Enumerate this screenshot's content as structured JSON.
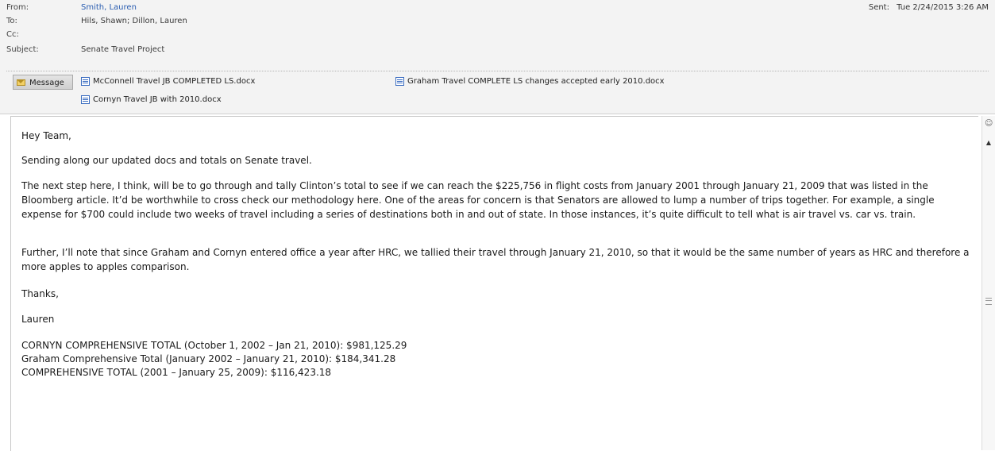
{
  "header": {
    "from_label": "From:",
    "from_value": "Smith, Lauren",
    "to_label": "To:",
    "to_value": "Hils, Shawn; Dillon, Lauren",
    "cc_label": "Cc:",
    "cc_value": "",
    "subject_label": "Subject:",
    "subject_value": "Senate Travel Project",
    "sent_label": "Sent:",
    "sent_value": "Tue 2/24/2015 3:26 AM"
  },
  "attachments": {
    "message_tab": "Message",
    "items": [
      "McConnell Travel JB COMPLETED LS.docx",
      "Graham Travel COMPLETE LS changes accepted early 2010.docx",
      "Cornyn Travel JB with 2010.docx"
    ]
  },
  "body": {
    "greeting": "Hey Team,",
    "p1": "Sending along our updated docs and totals on Senate travel.",
    "p2": "The next step here, I think, will be to go through and tally Clinton’s total to see if we can reach the $225,756 in flight costs from January 2001 through January 21, 2009 that was listed in the Bloomberg article. It’d be worthwhile to cross check our methodology here. One of the areas for concern is that Senators are allowed to lump a number of trips together. For example, a single expense for $700 could include two weeks of travel including a series of destinations both in and out of state. In those instances, it’s quite difficult to tell what is air travel vs. car vs. train.",
    "p3": "Further, I’ll note that since Graham and Cornyn entered office a year after HRC, we tallied their travel through January 21, 2010, so that it would be the same number of years as HRC and therefore a more apples to apples comparison.",
    "thanks": "Thanks,",
    "signature": "Lauren",
    "totals": [
      "CORNYN COMPREHENSIVE TOTAL (October 1, 2002 – Jan 21, 2010): $981,125.29",
      "Graham Comprehensive Total (January 2002 – January 21, 2010): $184,341.28",
      "COMPREHENSIVE TOTAL (2001 – January 25, 2009): $116,423.18"
    ]
  },
  "icons": {
    "message": "envelope-icon",
    "attachment": "word-document-icon",
    "scroll_top": "people-pane-icon",
    "scroll_up": "scroll-up-arrow-icon",
    "scroll_mid": "scroll-thumb-grip-icon"
  },
  "colors": {
    "link": "#2a5db0",
    "header_bg": "#f3f3f3"
  }
}
